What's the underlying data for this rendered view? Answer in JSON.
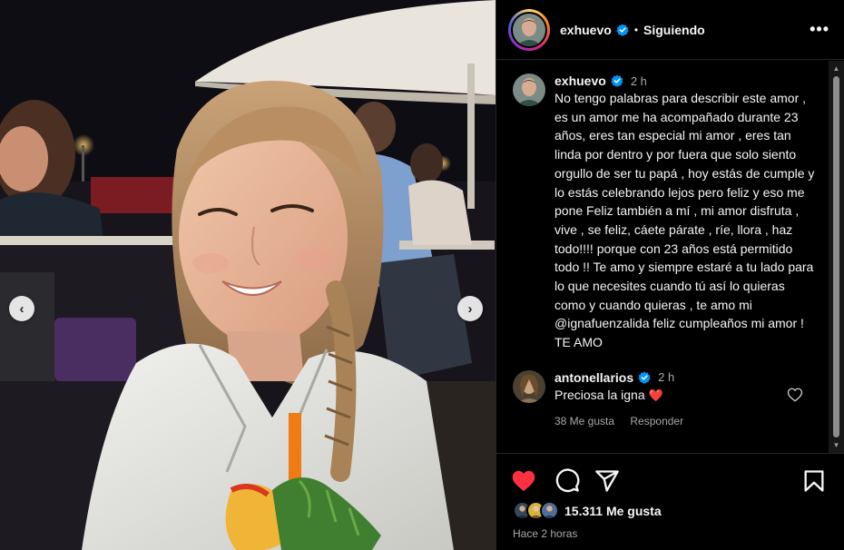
{
  "post": {
    "username": "exhuevo",
    "follow_status": "Siguiendo",
    "separator": "•",
    "more_glyph": "•••",
    "caption_time": "2 h",
    "caption": "No tengo palabras para describir este amor , es un amor me ha acompañado durante 23 años, eres tan especial mi amor , eres tan linda por dentro y por fuera que solo siento orgullo de ser tu papá , hoy estás de cumple y lo estás celebrando lejos pero feliz y eso me pone Feliz también a mí , mi amor disfruta , vive , se feliz, cáete párate , ríe, llora , haz todo!!!! porque con 23 años está permitido todo !! Te amo y siempre estaré a tu lado para lo que necesites cuando tú así lo quieras como y cuando quieras , te amo mi @ignafuenzalida feliz cumpleaños mi amor ! TE AMO"
  },
  "comments": [
    {
      "username": "antonellarios",
      "time": "2 h",
      "text": "Preciosa la igna",
      "emoji": "❤️",
      "likes": "38 Me gusta",
      "reply_label": "Responder"
    }
  ],
  "footer": {
    "likes": "15.311 Me gusta",
    "time_ago": "Hace 2 horas"
  },
  "carousel": {
    "prev_glyph": "‹",
    "next_glyph": "›"
  },
  "scroll": {
    "up_glyph": "▲",
    "down_glyph": "▼"
  },
  "colors": {
    "like_red": "#ff3040",
    "verified_blue": "#0095f6",
    "muted_text": "#a8a8a8"
  },
  "icons": {
    "like": "heart-icon",
    "comment": "comment-icon",
    "share": "send-icon",
    "save": "bookmark-icon",
    "verified": "verified-badge-icon",
    "more": "more-options-icon"
  }
}
